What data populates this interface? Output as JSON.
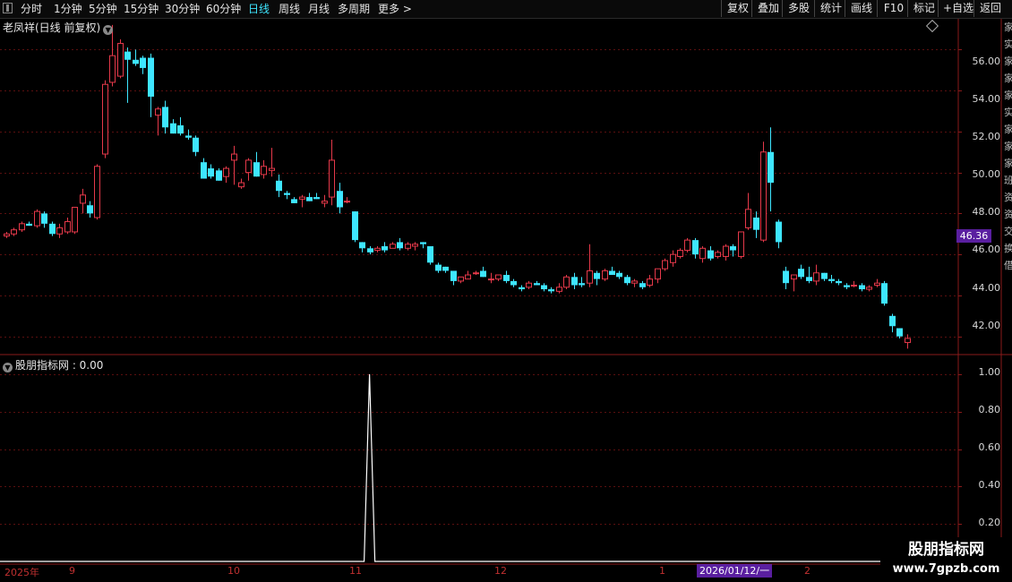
{
  "toolbar": {
    "periods": [
      "分时",
      "1分钟",
      "5分钟",
      "15分钟",
      "30分钟",
      "60分钟",
      "日线",
      "周线",
      "月线",
      "多周期"
    ],
    "active_period": "日线",
    "more_label": "更多 >",
    "actions": [
      "复权",
      "叠加",
      "多股",
      "统计",
      "画线",
      "F10",
      "标记",
      "+自选",
      "返回"
    ]
  },
  "stock": {
    "title": "老凤祥(日线 前复权)",
    "last_price": "46.36"
  },
  "indicator": {
    "title": "股朋指标网 : 0.00"
  },
  "price_axis": [
    "56.00",
    "54.00",
    "52.00",
    "50.00",
    "48.00",
    "46.00",
    "44.00",
    "42.00"
  ],
  "indicator_axis": [
    "1.00",
    "0.80",
    "0.60",
    "0.40",
    "0.20"
  ],
  "time_axis": [
    "2025年",
    "9",
    "10",
    "11",
    "12",
    "1",
    "2"
  ],
  "cursor_date": "2026/01/12/一",
  "right_strip_text": "家实家家家实家家家班资资交换借",
  "watermark": {
    "name": "股朋指标网",
    "url": "www.7gpzb.com"
  },
  "colors": {
    "up": "#e6394a",
    "down": "#3ee6ff",
    "grid": "#5a0f0f",
    "frame": "#8a1a1a",
    "highlight": "#5a1fa0"
  },
  "chart_data": {
    "type": "candlestick",
    "price_range": [
      41.2,
      57.5
    ],
    "indicator_range": [
      0,
      1.1
    ],
    "candles": [
      [
        46.9,
        47.1,
        46.8,
        47.0
      ],
      [
        47.0,
        47.3,
        46.9,
        47.2
      ],
      [
        47.2,
        47.6,
        47.1,
        47.5
      ],
      [
        47.5,
        47.6,
        47.4,
        47.4
      ],
      [
        47.4,
        48.2,
        47.3,
        48.1
      ],
      [
        48.0,
        48.1,
        47.3,
        47.5
      ],
      [
        47.5,
        47.6,
        46.9,
        47.0
      ],
      [
        47.0,
        47.5,
        46.8,
        47.3
      ],
      [
        47.1,
        47.8,
        47.0,
        47.6
      ],
      [
        47.1,
        48.3,
        47.0,
        48.3
      ],
      [
        48.5,
        49.2,
        48.0,
        48.9
      ],
      [
        48.4,
        48.6,
        47.8,
        48.0
      ],
      [
        47.8,
        50.4,
        47.7,
        50.3
      ],
      [
        50.9,
        54.5,
        50.7,
        54.3
      ],
      [
        54.4,
        57.2,
        54.2,
        55.7
      ],
      [
        54.7,
        56.5,
        54.6,
        56.3
      ],
      [
        55.9,
        56.1,
        53.4,
        55.5
      ],
      [
        55.5,
        56.0,
        55.2,
        55.3
      ],
      [
        55.6,
        55.7,
        54.8,
        55.1
      ],
      [
        55.6,
        55.8,
        52.7,
        53.7
      ],
      [
        52.8,
        53.2,
        51.8,
        53.1
      ],
      [
        53.2,
        53.5,
        51.9,
        52.2
      ],
      [
        52.4,
        52.6,
        51.9,
        51.9
      ],
      [
        52.3,
        52.7,
        51.8,
        51.9
      ],
      [
        51.8,
        52.1,
        51.6,
        51.7
      ],
      [
        51.7,
        51.8,
        50.8,
        51.0
      ],
      [
        50.5,
        50.7,
        49.7,
        49.7
      ],
      [
        50.2,
        50.4,
        49.7,
        49.8
      ],
      [
        50.1,
        50.2,
        49.6,
        49.6
      ],
      [
        49.8,
        50.3,
        49.5,
        50.2
      ],
      [
        50.6,
        51.3,
        49.4,
        50.9
      ],
      [
        49.3,
        49.7,
        49.2,
        49.5
      ],
      [
        50.0,
        50.7,
        49.6,
        50.6
      ],
      [
        50.5,
        51.0,
        49.8,
        49.8
      ],
      [
        49.9,
        50.6,
        49.7,
        50.3
      ],
      [
        50.1,
        51.2,
        49.8,
        50.2
      ],
      [
        49.6,
        49.9,
        48.8,
        49.1
      ],
      [
        49.0,
        49.1,
        48.7,
        48.9
      ],
      [
        48.7,
        48.8,
        48.5,
        48.5
      ],
      [
        48.7,
        48.9,
        48.3,
        48.8
      ],
      [
        48.8,
        49.0,
        48.6,
        48.6
      ],
      [
        48.8,
        49.0,
        48.7,
        48.7
      ],
      [
        48.5,
        48.9,
        48.3,
        48.6
      ],
      [
        48.8,
        51.6,
        48.4,
        50.6
      ],
      [
        49.1,
        49.5,
        48.0,
        48.3
      ],
      [
        48.6,
        48.8,
        48.5,
        48.6
      ],
      [
        48.1,
        48.1,
        46.6,
        46.7
      ],
      [
        46.6,
        46.6,
        46.1,
        46.3
      ],
      [
        46.3,
        46.4,
        46.0,
        46.1
      ],
      [
        46.2,
        46.4,
        46.1,
        46.3
      ],
      [
        46.4,
        46.6,
        46.1,
        46.2
      ],
      [
        46.3,
        46.6,
        46.3,
        46.5
      ],
      [
        46.6,
        46.8,
        46.2,
        46.3
      ],
      [
        46.3,
        46.6,
        46.2,
        46.5
      ],
      [
        46.4,
        46.6,
        46.2,
        46.5
      ],
      [
        46.6,
        46.6,
        46.3,
        46.5
      ],
      [
        46.4,
        46.4,
        45.5,
        45.6
      ],
      [
        45.5,
        45.6,
        45.1,
        45.2
      ],
      [
        45.4,
        45.4,
        45.1,
        45.2
      ],
      [
        45.2,
        45.2,
        44.5,
        44.7
      ],
      [
        44.7,
        44.9,
        44.6,
        44.9
      ],
      [
        44.8,
        45.2,
        44.8,
        45.0
      ],
      [
        45.1,
        45.2,
        45.0,
        45.1
      ],
      [
        45.2,
        45.4,
        44.9,
        44.9
      ],
      [
        44.8,
        45.1,
        44.6,
        44.8
      ],
      [
        44.8,
        45.0,
        44.7,
        45.0
      ],
      [
        45.0,
        45.2,
        44.6,
        44.7
      ],
      [
        44.7,
        44.8,
        44.4,
        44.5
      ],
      [
        44.4,
        44.5,
        44.2,
        44.3
      ],
      [
        44.4,
        44.7,
        44.3,
        44.6
      ],
      [
        44.6,
        44.7,
        44.5,
        44.5
      ],
      [
        44.5,
        44.6,
        44.2,
        44.3
      ],
      [
        44.3,
        44.4,
        44.1,
        44.2
      ],
      [
        44.2,
        44.6,
        44.1,
        44.4
      ],
      [
        44.4,
        45.0,
        44.3,
        44.9
      ],
      [
        44.9,
        45.1,
        44.3,
        44.5
      ],
      [
        44.6,
        44.9,
        44.4,
        44.5
      ],
      [
        44.6,
        46.5,
        44.4,
        45.2
      ],
      [
        45.1,
        45.2,
        44.5,
        44.8
      ],
      [
        44.8,
        45.3,
        44.7,
        45.2
      ],
      [
        45.2,
        45.4,
        45.0,
        45.0
      ],
      [
        45.1,
        45.2,
        44.8,
        44.9
      ],
      [
        44.9,
        45.0,
        44.5,
        44.6
      ],
      [
        44.6,
        44.8,
        44.4,
        44.7
      ],
      [
        44.6,
        44.7,
        44.3,
        44.4
      ],
      [
        44.5,
        45.0,
        44.4,
        44.8
      ],
      [
        44.8,
        45.3,
        44.6,
        45.3
      ],
      [
        45.3,
        45.8,
        45.2,
        45.7
      ],
      [
        45.6,
        46.2,
        45.4,
        46.0
      ],
      [
        45.9,
        46.3,
        45.8,
        46.2
      ],
      [
        46.2,
        46.8,
        46.1,
        46.7
      ],
      [
        46.7,
        46.8,
        45.8,
        46.0
      ],
      [
        45.8,
        46.4,
        45.6,
        46.3
      ],
      [
        46.2,
        46.4,
        45.7,
        45.8
      ],
      [
        45.9,
        46.2,
        45.8,
        46.1
      ],
      [
        45.9,
        46.5,
        45.7,
        46.4
      ],
      [
        46.4,
        46.5,
        45.9,
        46.2
      ],
      [
        45.9,
        47.1,
        45.8,
        47.1
      ],
      [
        47.3,
        49.0,
        47.2,
        48.2
      ],
      [
        47.8,
        48.1,
        46.8,
        47.2
      ],
      [
        46.7,
        51.5,
        46.6,
        51.0
      ],
      [
        51.0,
        52.2,
        48.1,
        49.5
      ],
      [
        47.6,
        47.7,
        46.3,
        46.6
      ],
      [
        45.2,
        45.4,
        44.3,
        44.6
      ],
      [
        44.8,
        45.0,
        44.2,
        45.0
      ],
      [
        45.3,
        45.5,
        44.8,
        44.9
      ],
      [
        44.9,
        45.4,
        44.6,
        44.7
      ],
      [
        44.7,
        45.5,
        44.5,
        45.1
      ],
      [
        45.1,
        45.1,
        44.7,
        44.8
      ],
      [
        44.8,
        45.0,
        44.6,
        44.7
      ],
      [
        44.7,
        44.8,
        44.5,
        44.6
      ],
      [
        44.5,
        44.6,
        44.3,
        44.4
      ],
      [
        44.5,
        44.7,
        44.4,
        44.5
      ],
      [
        44.5,
        44.6,
        44.2,
        44.3
      ],
      [
        44.3,
        44.5,
        44.2,
        44.4
      ],
      [
        44.5,
        44.8,
        44.4,
        44.6
      ],
      [
        44.6,
        44.7,
        43.5,
        43.6
      ],
      [
        43.0,
        43.1,
        42.2,
        42.5
      ],
      [
        42.4,
        42.4,
        41.9,
        42.0
      ],
      [
        41.7,
        42.1,
        41.4,
        41.9
      ]
    ],
    "indicator_peak_index": 48
  }
}
